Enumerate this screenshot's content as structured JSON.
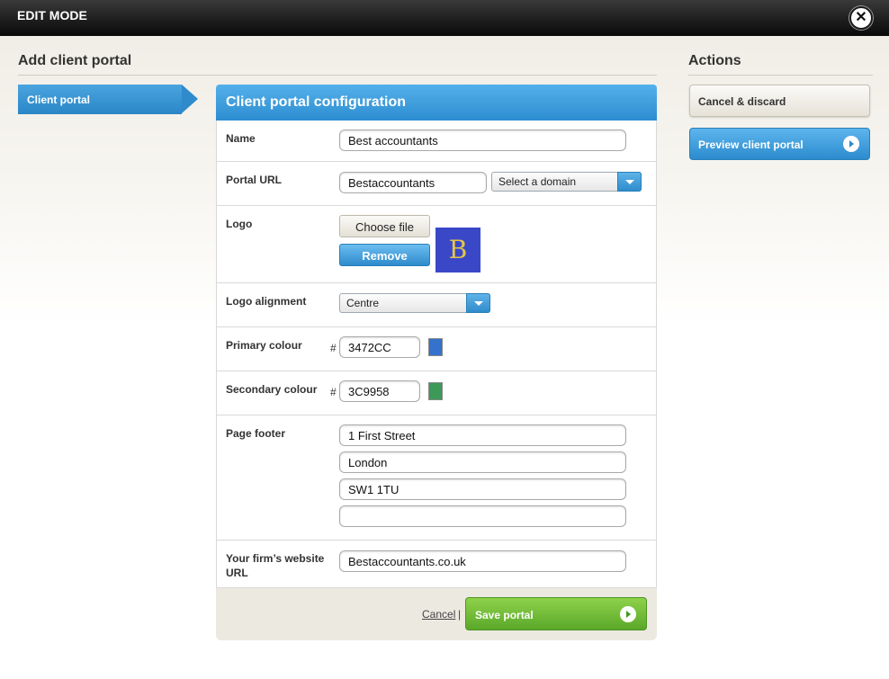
{
  "topbar": {
    "title": "EDIT MODE"
  },
  "page": {
    "heading": "Add client portal",
    "actions_heading": "Actions"
  },
  "sidebar": {
    "items": [
      {
        "label": "Client portal"
      }
    ]
  },
  "panel": {
    "title": "Client portal configuration",
    "name": {
      "label": "Name",
      "value": "Best accountants"
    },
    "portal_url": {
      "label": "Portal URL",
      "value": "Bestaccountants",
      "domain_select": "Select a domain"
    },
    "logo": {
      "label": "Logo",
      "choose_label": "Choose file",
      "remove_label": "Remove",
      "preview_letter": "B",
      "preview_bg": "#3A48C8"
    },
    "logo_alignment": {
      "label": "Logo alignment",
      "value": "Centre"
    },
    "primary_colour": {
      "label": "Primary colour",
      "hash": "#",
      "value": "3472CC",
      "swatch": "#3472CC"
    },
    "secondary_colour": {
      "label": "Secondary colour",
      "hash": "#",
      "value": "3C9958",
      "swatch": "#3C9958"
    },
    "page_footer": {
      "label": "Page footer",
      "lines": [
        "1 First Street",
        "London",
        "SW1 1TU",
        ""
      ]
    },
    "website": {
      "label": "Your firm’s website URL",
      "value": "Bestaccountants.co.uk"
    },
    "cancel_link": "Cancel",
    "separator": "|",
    "save_label": "Save portal"
  },
  "actions": {
    "cancel_label": "Cancel & discard",
    "preview_label": "Preview client portal"
  }
}
